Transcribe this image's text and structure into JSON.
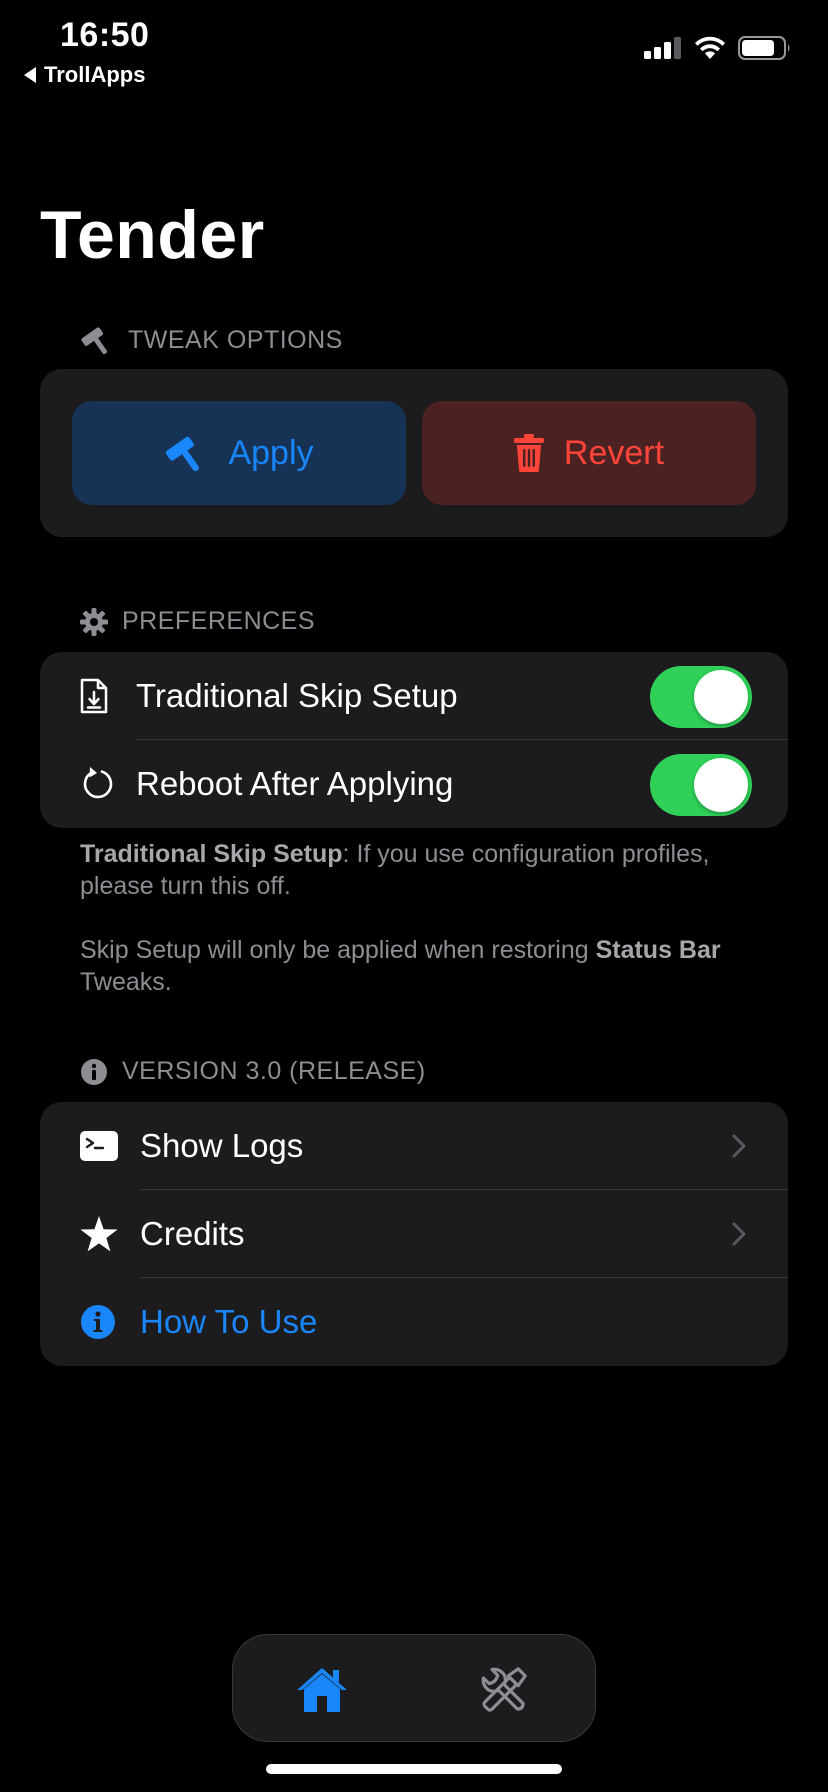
{
  "status_bar": {
    "time": "16:50",
    "back_app": "TrollApps",
    "icons": [
      "signal-icon",
      "wifi-icon",
      "battery-icon"
    ]
  },
  "page": {
    "title": "Tender"
  },
  "tweak_options": {
    "header": "TWEAK OPTIONS",
    "header_icon": "hammer-icon",
    "apply_label": "Apply",
    "revert_label": "Revert"
  },
  "preferences": {
    "header": "PREFERENCES",
    "header_icon": "gear-icon",
    "items": [
      {
        "label": "Traditional Skip Setup",
        "icon": "document-download-icon",
        "enabled": true
      },
      {
        "label": "Reboot After Applying",
        "icon": "restart-icon",
        "enabled": true
      }
    ],
    "footnote": {
      "p1_bold": "Traditional Skip Setup",
      "p1_rest": ": If you use configuration profiles, please turn this off.",
      "p2_start": "Skip Setup will only be applied when restoring ",
      "p2_bold": "Status Bar",
      "p2_end": " Tweaks."
    }
  },
  "about": {
    "header": "VERSION 3.0 (RELEASE)",
    "header_icon": "info-icon",
    "items": [
      {
        "label": "Show Logs",
        "icon": "terminal-icon"
      },
      {
        "label": "Credits",
        "icon": "star-icon"
      },
      {
        "label": "How To Use",
        "icon": "info-circle-icon"
      }
    ]
  },
  "tab_bar": {
    "tabs": [
      {
        "name": "home",
        "icon": "house-icon",
        "selected": true
      },
      {
        "name": "tools",
        "icon": "tools-icon",
        "selected": false
      }
    ]
  },
  "colors": {
    "accent": "#1a86fb",
    "destructive": "#ff453a",
    "toggle_on": "#30d158",
    "card": "#1c1c1e",
    "background": "#000000"
  }
}
